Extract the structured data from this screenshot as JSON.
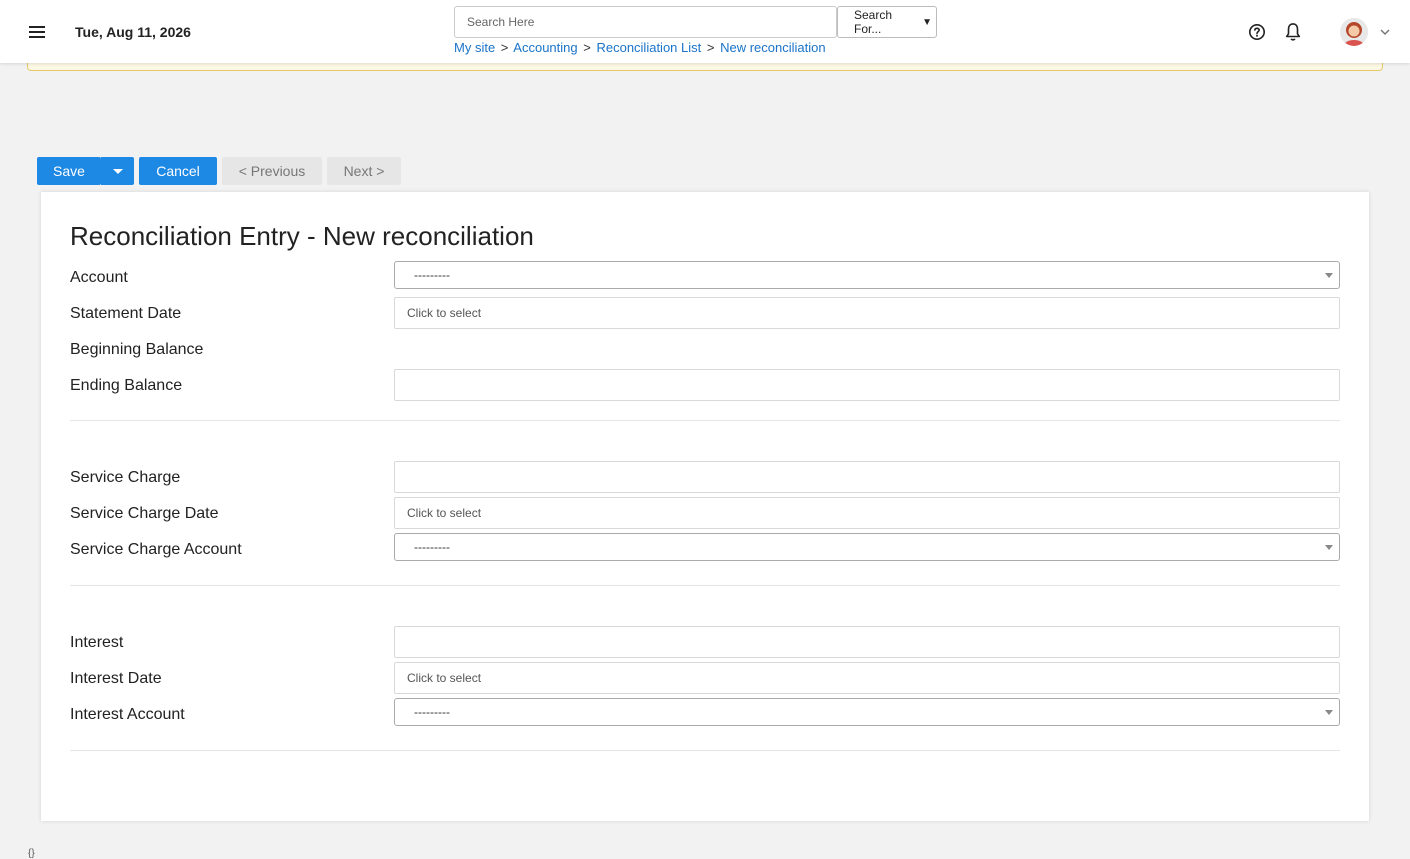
{
  "header": {
    "date": "Tue, Aug 11, 2026",
    "search_placeholder": "Search Here",
    "search_for": "Search For...",
    "breadcrumb": [
      "My site",
      "Accounting",
      "Reconciliation List",
      "New reconciliation"
    ],
    "separator": ">"
  },
  "toolbar": {
    "save": "Save",
    "cancel": "Cancel",
    "previous": "< Previous",
    "next": "Next >"
  },
  "form": {
    "title": "Reconciliation Entry - New reconciliation",
    "account": {
      "label": "Account",
      "value": "---------"
    },
    "statement_date": {
      "label": "Statement Date",
      "placeholder": "Click to select"
    },
    "beginning_balance": {
      "label": "Beginning Balance"
    },
    "ending_balance": {
      "label": "Ending Balance",
      "value": ""
    },
    "service_charge": {
      "label": "Service Charge",
      "value": ""
    },
    "service_charge_date": {
      "label": "Service Charge Date",
      "placeholder": "Click to select"
    },
    "service_charge_account": {
      "label": "Service Charge Account",
      "value": "---------"
    },
    "interest": {
      "label": "Interest",
      "value": ""
    },
    "interest_date": {
      "label": "Interest Date",
      "placeholder": "Click to select"
    },
    "interest_account": {
      "label": "Interest Account",
      "value": "---------"
    }
  },
  "footer_mark": "{}",
  "colors": {
    "primary": "#1e88e5",
    "link": "#1a73c9",
    "alert_border": "#e6c86a",
    "page_bg": "#f2f2f2"
  }
}
